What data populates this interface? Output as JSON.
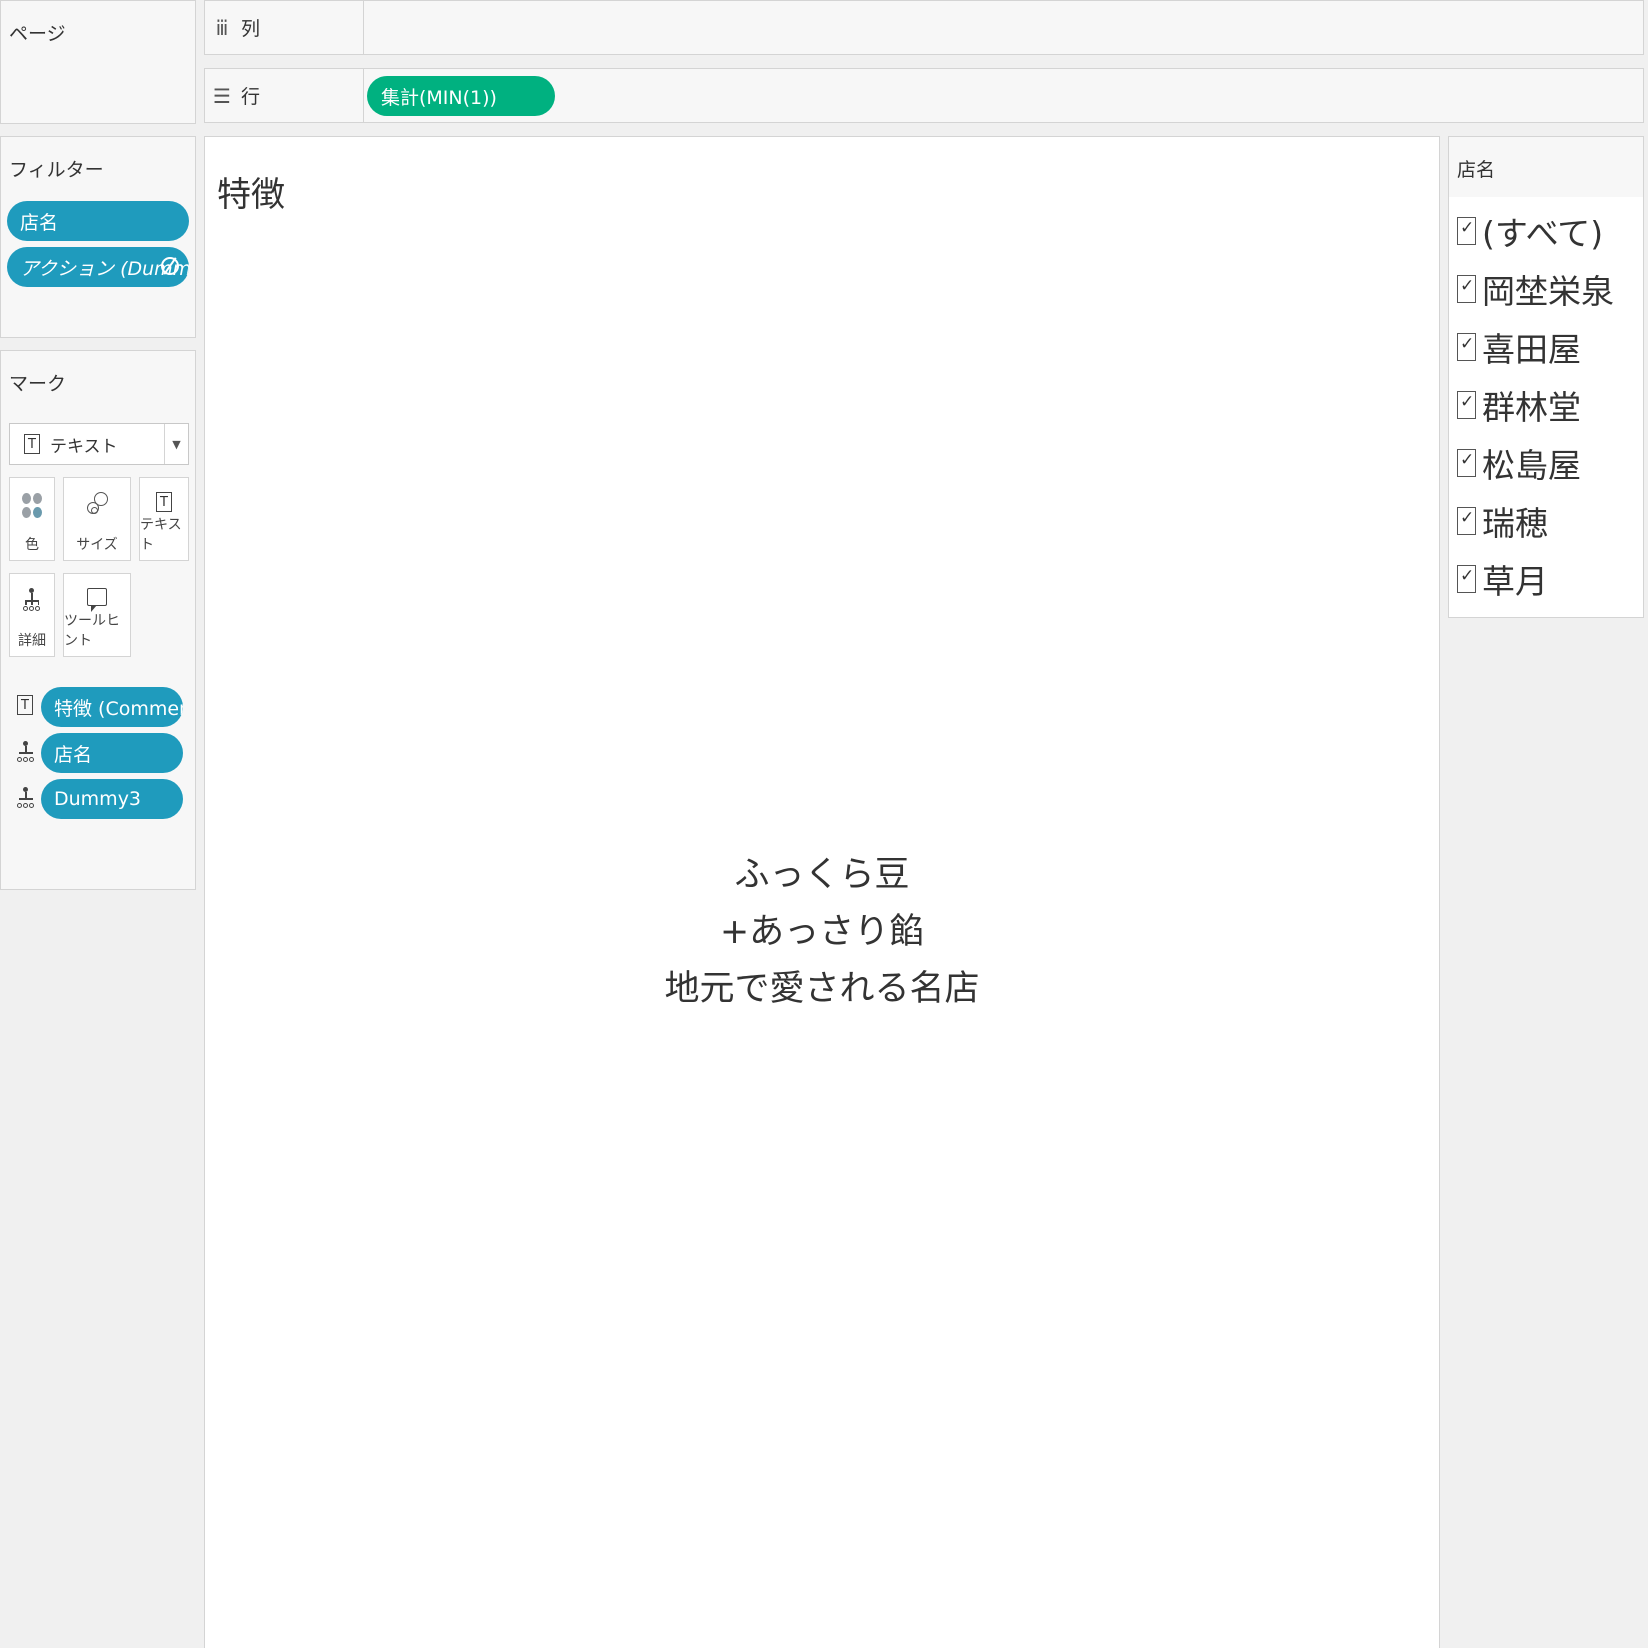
{
  "pages": {
    "title": "ページ"
  },
  "shelves": {
    "columns": {
      "label": "列",
      "icon": "columns-icon"
    },
    "rows": {
      "label": "行",
      "icon": "rows-icon",
      "pill": "集計(MIN(1))"
    }
  },
  "filters": {
    "title": "フィルター",
    "items": [
      "店名",
      "アクション (Dumm.."
    ]
  },
  "marks": {
    "title": "マーク",
    "type": "テキスト",
    "buttons": {
      "color": "色",
      "size": "サイズ",
      "text": "テキスト",
      "detail": "詳細",
      "tooltip": "ツールヒント"
    },
    "fields": [
      {
        "icon": "text-icon",
        "label": "特徴 (Comment)"
      },
      {
        "icon": "detail-icon",
        "label": "店名"
      },
      {
        "icon": "detail-icon",
        "label": "Dummy3"
      }
    ]
  },
  "view": {
    "title": "特徴",
    "lines": [
      "ふっくら豆",
      "+あっさり餡",
      "地元で愛される名店"
    ]
  },
  "legend": {
    "title": "店名",
    "items": [
      "(すべて)",
      "岡埜栄泉",
      "喜田屋",
      "群林堂",
      "松島屋",
      "瑞穂",
      "草月"
    ],
    "checked": true
  },
  "colors": {
    "blue_pill": "#1f9bbd",
    "green_pill": "#00b180",
    "panel_bg": "#f7f7f7"
  }
}
